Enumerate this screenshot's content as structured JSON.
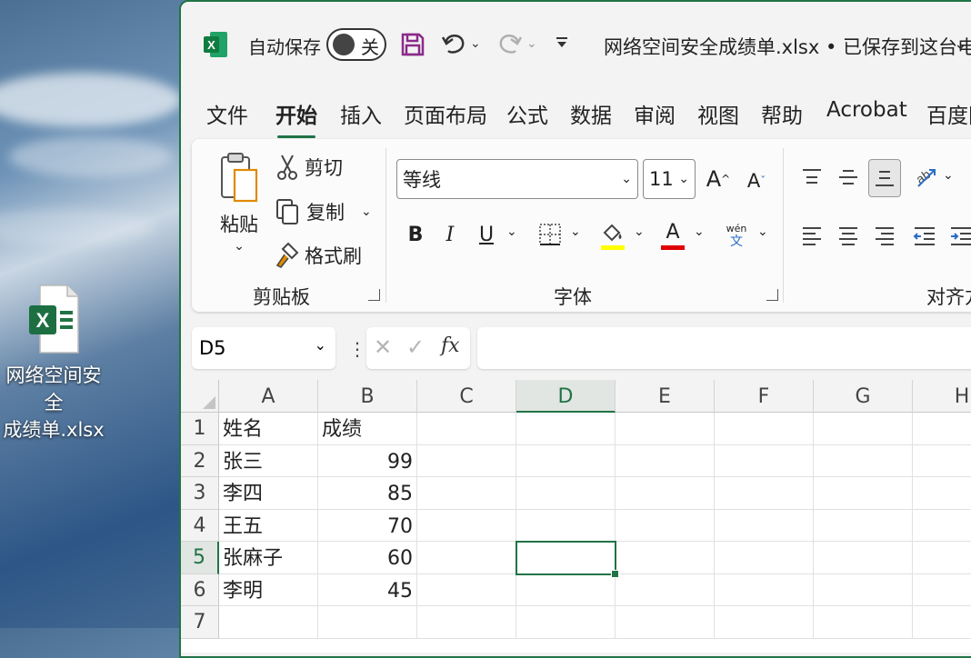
{
  "desktop": {
    "file_icon_label": "网络空间安全\n成绩单.xlsx",
    "file_icon_label_line1": "网络空间安全",
    "file_icon_label_line2": "成绩单.xlsx"
  },
  "titlebar": {
    "autosave_label": "自动保存",
    "autosave_state": "关",
    "title": "网络空间安全成绩单.xlsx • 已保存到这台电脑"
  },
  "menu": {
    "items": [
      "文件",
      "开始",
      "插入",
      "页面布局",
      "公式",
      "数据",
      "审阅",
      "视图",
      "帮助",
      "Acrobat",
      "百度网"
    ],
    "active": "开始"
  },
  "ribbon": {
    "clipboard": {
      "paste_label": "粘贴",
      "cut_label": "剪切",
      "copy_label": "复制",
      "format_painter_label": "格式刷",
      "group_label": "剪贴板"
    },
    "font": {
      "font_name": "等线",
      "font_size": "11",
      "bold": "B",
      "italic": "I",
      "underline": "U",
      "font_color_glyph": "A",
      "phonetic_top": "wén",
      "phonetic_bottom": "文",
      "group_label": "字体",
      "fill_color": "#ffff00",
      "font_color": "#e00000"
    },
    "alignment": {
      "group_label": "对齐方"
    }
  },
  "formula_bar": {
    "name_box": "D5",
    "fx_label": "fx",
    "formula": ""
  },
  "sheet": {
    "columns": [
      "A",
      "B",
      "C",
      "D",
      "E",
      "F",
      "G",
      "H"
    ],
    "selected_column": "D",
    "selected_row": "5",
    "rows": [
      {
        "num": "1",
        "a": "姓名",
        "b": "成绩"
      },
      {
        "num": "2",
        "a": "张三",
        "b": "99"
      },
      {
        "num": "3",
        "a": "李四",
        "b": "85"
      },
      {
        "num": "4",
        "a": "王五",
        "b": "70"
      },
      {
        "num": "5",
        "a": "张麻子",
        "b": "60"
      },
      {
        "num": "6",
        "a": "李明",
        "b": "45"
      },
      {
        "num": "7",
        "a": "",
        "b": ""
      }
    ]
  },
  "colors": {
    "excel_green": "#217346"
  }
}
